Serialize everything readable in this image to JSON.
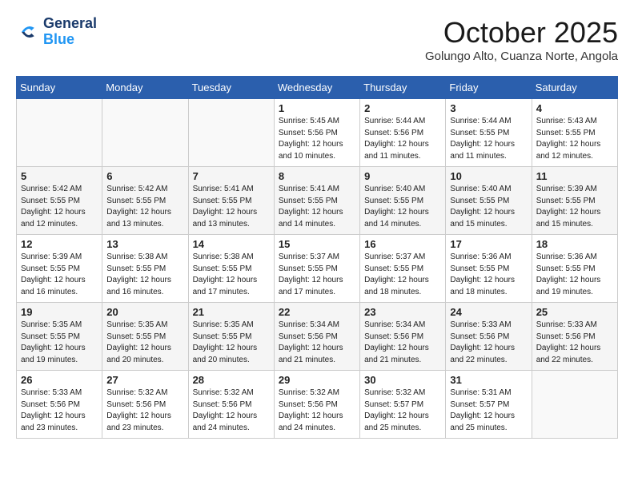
{
  "header": {
    "logo_line1": "General",
    "logo_line2": "Blue",
    "month": "October 2025",
    "location": "Golungo Alto, Cuanza Norte, Angola"
  },
  "weekdays": [
    "Sunday",
    "Monday",
    "Tuesday",
    "Wednesday",
    "Thursday",
    "Friday",
    "Saturday"
  ],
  "weeks": [
    [
      {
        "day": "",
        "info": ""
      },
      {
        "day": "",
        "info": ""
      },
      {
        "day": "",
        "info": ""
      },
      {
        "day": "1",
        "info": "Sunrise: 5:45 AM\nSunset: 5:56 PM\nDaylight: 12 hours\nand 10 minutes."
      },
      {
        "day": "2",
        "info": "Sunrise: 5:44 AM\nSunset: 5:56 PM\nDaylight: 12 hours\nand 11 minutes."
      },
      {
        "day": "3",
        "info": "Sunrise: 5:44 AM\nSunset: 5:55 PM\nDaylight: 12 hours\nand 11 minutes."
      },
      {
        "day": "4",
        "info": "Sunrise: 5:43 AM\nSunset: 5:55 PM\nDaylight: 12 hours\nand 12 minutes."
      }
    ],
    [
      {
        "day": "5",
        "info": "Sunrise: 5:42 AM\nSunset: 5:55 PM\nDaylight: 12 hours\nand 12 minutes."
      },
      {
        "day": "6",
        "info": "Sunrise: 5:42 AM\nSunset: 5:55 PM\nDaylight: 12 hours\nand 13 minutes."
      },
      {
        "day": "7",
        "info": "Sunrise: 5:41 AM\nSunset: 5:55 PM\nDaylight: 12 hours\nand 13 minutes."
      },
      {
        "day": "8",
        "info": "Sunrise: 5:41 AM\nSunset: 5:55 PM\nDaylight: 12 hours\nand 14 minutes."
      },
      {
        "day": "9",
        "info": "Sunrise: 5:40 AM\nSunset: 5:55 PM\nDaylight: 12 hours\nand 14 minutes."
      },
      {
        "day": "10",
        "info": "Sunrise: 5:40 AM\nSunset: 5:55 PM\nDaylight: 12 hours\nand 15 minutes."
      },
      {
        "day": "11",
        "info": "Sunrise: 5:39 AM\nSunset: 5:55 PM\nDaylight: 12 hours\nand 15 minutes."
      }
    ],
    [
      {
        "day": "12",
        "info": "Sunrise: 5:39 AM\nSunset: 5:55 PM\nDaylight: 12 hours\nand 16 minutes."
      },
      {
        "day": "13",
        "info": "Sunrise: 5:38 AM\nSunset: 5:55 PM\nDaylight: 12 hours\nand 16 minutes."
      },
      {
        "day": "14",
        "info": "Sunrise: 5:38 AM\nSunset: 5:55 PM\nDaylight: 12 hours\nand 17 minutes."
      },
      {
        "day": "15",
        "info": "Sunrise: 5:37 AM\nSunset: 5:55 PM\nDaylight: 12 hours\nand 17 minutes."
      },
      {
        "day": "16",
        "info": "Sunrise: 5:37 AM\nSunset: 5:55 PM\nDaylight: 12 hours\nand 18 minutes."
      },
      {
        "day": "17",
        "info": "Sunrise: 5:36 AM\nSunset: 5:55 PM\nDaylight: 12 hours\nand 18 minutes."
      },
      {
        "day": "18",
        "info": "Sunrise: 5:36 AM\nSunset: 5:55 PM\nDaylight: 12 hours\nand 19 minutes."
      }
    ],
    [
      {
        "day": "19",
        "info": "Sunrise: 5:35 AM\nSunset: 5:55 PM\nDaylight: 12 hours\nand 19 minutes."
      },
      {
        "day": "20",
        "info": "Sunrise: 5:35 AM\nSunset: 5:55 PM\nDaylight: 12 hours\nand 20 minutes."
      },
      {
        "day": "21",
        "info": "Sunrise: 5:35 AM\nSunset: 5:55 PM\nDaylight: 12 hours\nand 20 minutes."
      },
      {
        "day": "22",
        "info": "Sunrise: 5:34 AM\nSunset: 5:56 PM\nDaylight: 12 hours\nand 21 minutes."
      },
      {
        "day": "23",
        "info": "Sunrise: 5:34 AM\nSunset: 5:56 PM\nDaylight: 12 hours\nand 21 minutes."
      },
      {
        "day": "24",
        "info": "Sunrise: 5:33 AM\nSunset: 5:56 PM\nDaylight: 12 hours\nand 22 minutes."
      },
      {
        "day": "25",
        "info": "Sunrise: 5:33 AM\nSunset: 5:56 PM\nDaylight: 12 hours\nand 22 minutes."
      }
    ],
    [
      {
        "day": "26",
        "info": "Sunrise: 5:33 AM\nSunset: 5:56 PM\nDaylight: 12 hours\nand 23 minutes."
      },
      {
        "day": "27",
        "info": "Sunrise: 5:32 AM\nSunset: 5:56 PM\nDaylight: 12 hours\nand 23 minutes."
      },
      {
        "day": "28",
        "info": "Sunrise: 5:32 AM\nSunset: 5:56 PM\nDaylight: 12 hours\nand 24 minutes."
      },
      {
        "day": "29",
        "info": "Sunrise: 5:32 AM\nSunset: 5:56 PM\nDaylight: 12 hours\nand 24 minutes."
      },
      {
        "day": "30",
        "info": "Sunrise: 5:32 AM\nSunset: 5:57 PM\nDaylight: 12 hours\nand 25 minutes."
      },
      {
        "day": "31",
        "info": "Sunrise: 5:31 AM\nSunset: 5:57 PM\nDaylight: 12 hours\nand 25 minutes."
      },
      {
        "day": "",
        "info": ""
      }
    ]
  ]
}
